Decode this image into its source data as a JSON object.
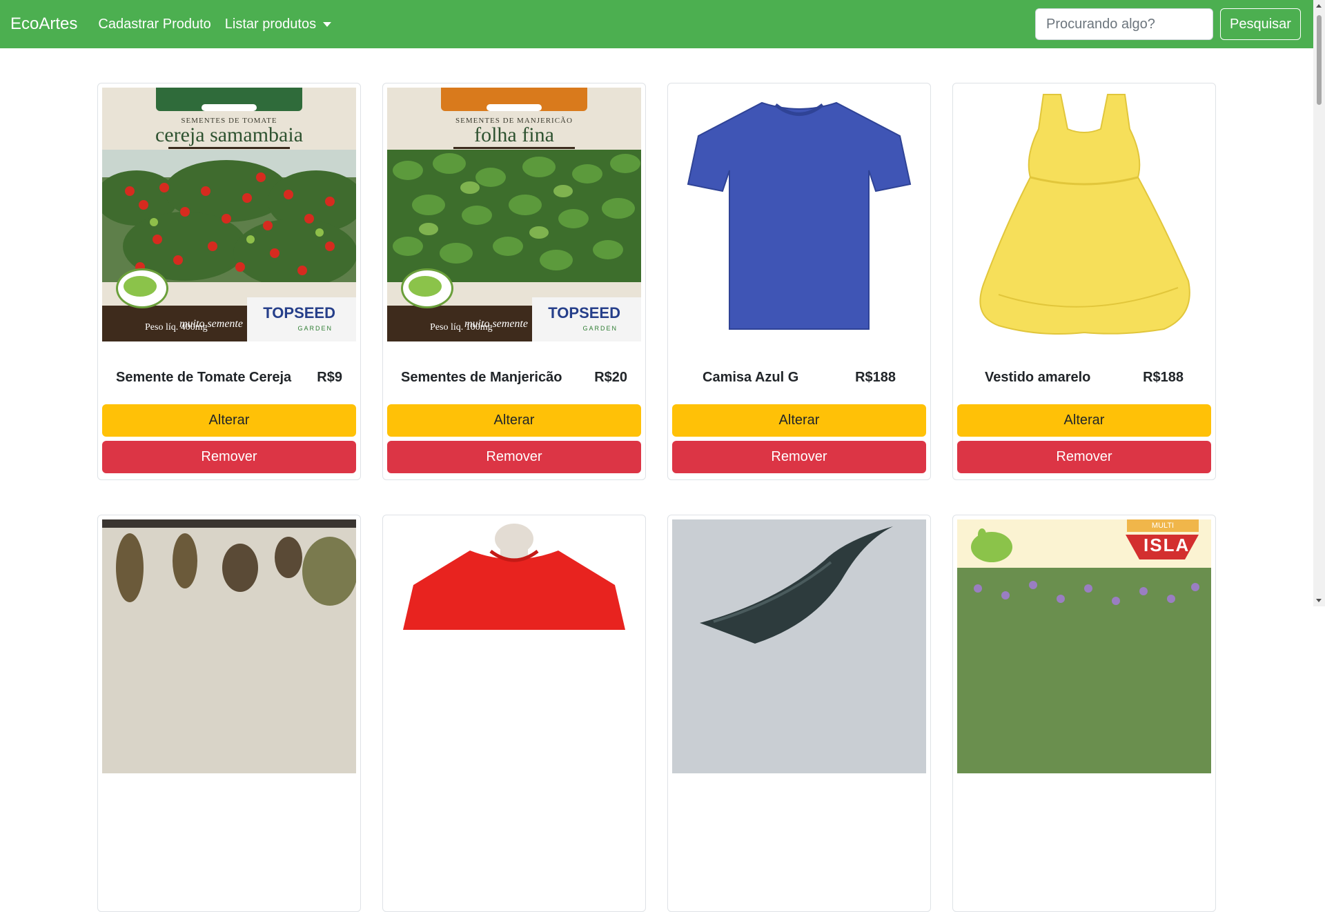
{
  "navbar": {
    "brand": "EcoArtes",
    "links": {
      "register": "Cadastrar Produto",
      "list": "Listar produtos"
    },
    "search": {
      "placeholder": "Procurando algo?",
      "value": "",
      "button": "Pesquisar"
    }
  },
  "colors": {
    "navbar": "#4caf50",
    "warning": "#ffc107",
    "danger": "#dc3545"
  },
  "products": [
    {
      "name": "Semente de Tomate Cereja",
      "price": "R$9",
      "edit_label": "Alterar",
      "remove_label": "Remover",
      "packet": {
        "subtitle": "SEMENTES DE TOMATE",
        "title": "cereja samambaia",
        "weight": "Peso líq. 400mg",
        "slogan": "muito semente",
        "logo": "TOPSEED",
        "logo_sub": "GARDEN"
      }
    },
    {
      "name": "Sementes de Manjericão",
      "price": "R$20",
      "edit_label": "Alterar",
      "remove_label": "Remover",
      "packet": {
        "subtitle": "SEMENTES DE MANJERICÃO",
        "title": "folha fina",
        "weight": "Peso líq. 100mg",
        "slogan": "muito semente",
        "logo": "TOPSEED",
        "logo_sub": "GARDEN"
      }
    },
    {
      "name": "Camisa Azul G",
      "price": "R$188",
      "edit_label": "Alterar",
      "remove_label": "Remover"
    },
    {
      "name": "Vestido amarelo",
      "price": "R$188",
      "edit_label": "Alterar",
      "remove_label": "Remover"
    },
    {
      "name": "",
      "price": ""
    },
    {
      "name": "",
      "price": ""
    },
    {
      "name": "",
      "price": ""
    },
    {
      "name": "",
      "price": "",
      "packet": {
        "banner": "MULTI",
        "logo": "ISLA"
      }
    }
  ]
}
